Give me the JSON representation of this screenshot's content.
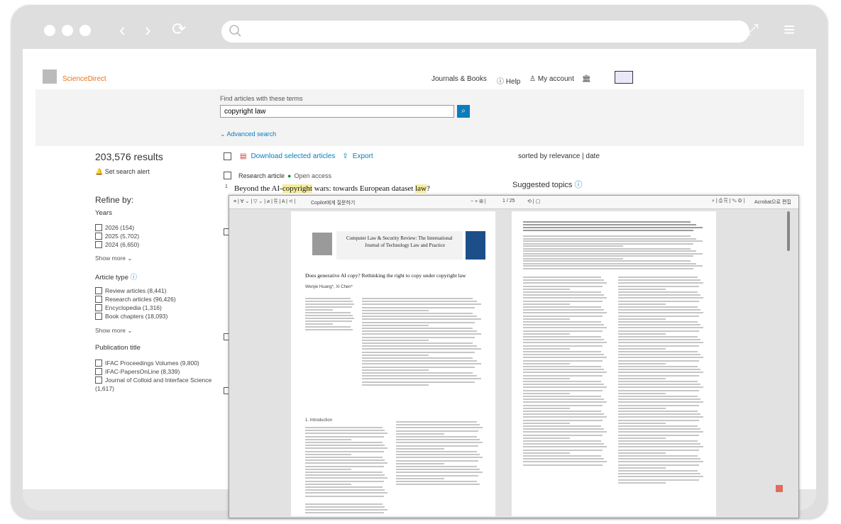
{
  "browser": {
    "controls": {
      "back": "‹",
      "forward": "›",
      "reload": "⟳",
      "expand": "⤢",
      "menu": "≡"
    },
    "icons": [
      "search-icon",
      "reload-icon",
      "expand-icon",
      "menu-icon"
    ]
  },
  "header": {
    "logo_text": "ScienceDirect",
    "journals": "Journals & Books",
    "help": "Help",
    "account": "My account"
  },
  "search": {
    "label": "Find articles with these terms",
    "value": "copyright law",
    "advanced": "Advanced search"
  },
  "results": {
    "count": "203,576 results",
    "alert": "Set search alert",
    "refine": "Refine by:",
    "download": "Download selected articles",
    "export": "Export",
    "sorted": "sorted by relevance | date",
    "article_type_label": "Research article",
    "open_access": "Open access",
    "index": "1",
    "first_title_pre": "Beyond the AI-",
    "first_title_hl": "copyright",
    "first_title_mid": " wars: towards European dataset ",
    "first_title_hl2": "law",
    "first_title_post": "?",
    "suggested": "Suggested topics"
  },
  "filters": {
    "years_title": "Years",
    "years": [
      "2026 (154)",
      "2025 (5,702)",
      "2024 (6,650)"
    ],
    "show_more": "Show more",
    "article_type_title": "Article type",
    "types": [
      "Review articles (8,441)",
      "Research articles (96,426)",
      "Encyclopedia (1,316)",
      "Book chapters (18,093)"
    ],
    "publication_title": "Publication title",
    "pubs": [
      "IFAC Proceedings Volumes (9,800)",
      "IFAC-PapersOnLine (8,339)",
      "Journal of Colloid and Interface Science",
      "(1,617)"
    ]
  },
  "pdf": {
    "doc_title": "Copilot에게 질문하기",
    "page_indicator": "1",
    "page_total": "/ 25",
    "right_label": "Acrobat으로 편집",
    "journal_title_1": "Computer Law & Security Review: The International",
    "journal_title_2": "Journal of Technology Law and Practice",
    "paper_title": "Does generative AI copy? Rethinking the right to copy under copyright law",
    "authors": "Wenjie Huang*, Xi Chen*",
    "section1": "1. Introduction"
  }
}
